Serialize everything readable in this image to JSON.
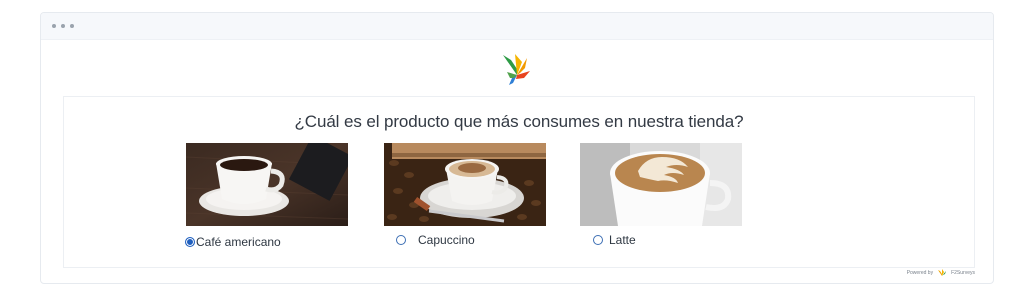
{
  "window": {
    "dots": 3
  },
  "survey": {
    "question": "¿Cuál es el producto que más consumes en nuestra tienda?",
    "options": [
      {
        "label": "Café americano",
        "selected": true,
        "image": "black-coffee-cup-icon"
      },
      {
        "label": "Capuccino",
        "selected": false,
        "image": "cappuccino-cup-icon"
      },
      {
        "label": "Latte",
        "selected": false,
        "image": "latte-art-cup-icon"
      }
    ]
  },
  "footer": {
    "powered_by": "Powered by",
    "brand": "F2Surveys"
  },
  "colors": {
    "radio_selected": "#1f5fbf",
    "radio_border": "#3d6fb4",
    "text": "#333a44"
  }
}
